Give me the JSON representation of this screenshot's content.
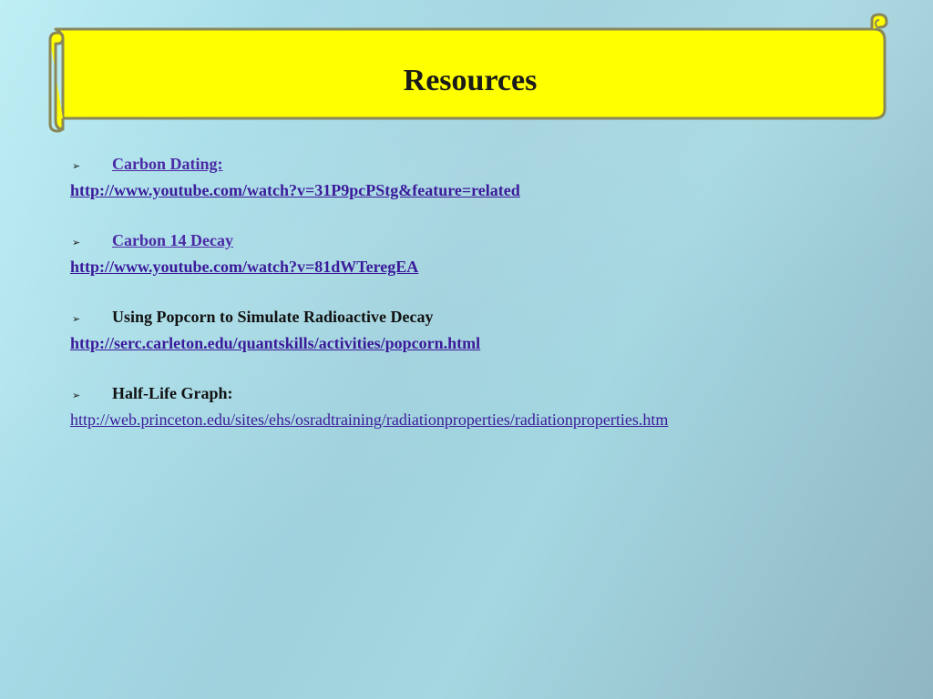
{
  "slide": {
    "title": "Resources",
    "colors": {
      "banner_fill": "#ffff00",
      "banner_stroke": "#8a8758",
      "link": "#3b1a9a",
      "text": "#111111"
    }
  },
  "resources": [
    {
      "bullet": "➢",
      "title": "Carbon Dating:",
      "title_is_link": true,
      "url": "http://www.youtube.com/watch?v=31P9pcPStg&feature=related"
    },
    {
      "bullet": "➢",
      "title": "Carbon 14 Decay",
      "title_is_link": true,
      "url": "http://www.youtube.com/watch?v=81dWTeregEA"
    },
    {
      "bullet": "➢",
      "title": "Using Popcorn to Simulate Radioactive Decay",
      "title_is_link": false,
      "url": "http://serc.carleton.edu/quantskills/activities/popcorn.html"
    },
    {
      "bullet": "➢",
      "title": "Half-Life Graph:",
      "title_is_link": false,
      "url": "http://web.princeton.edu/sites/ehs/osradtraining/radiationproperties/radiationproperties.htm"
    }
  ]
}
